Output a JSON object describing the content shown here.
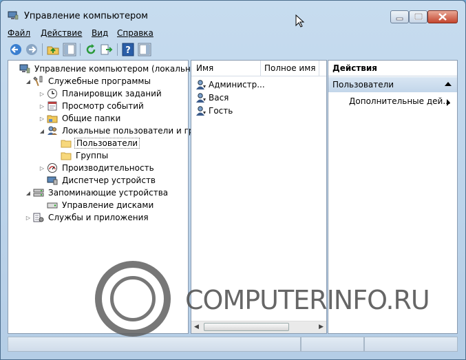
{
  "window": {
    "title": "Управление компьютером"
  },
  "menu": {
    "items": [
      {
        "label": "Файл",
        "accel": "Ф"
      },
      {
        "label": "Действие",
        "accel": "Д"
      },
      {
        "label": "Вид",
        "accel": "В"
      },
      {
        "label": "Справка",
        "accel": "С"
      }
    ]
  },
  "toolbar": {
    "icons": [
      "back-arrow-icon",
      "forward-arrow-icon",
      "up-folder-icon",
      "show-hide-tree-icon",
      "refresh-icon",
      "export-list-icon",
      "help-icon",
      "show-hide-action-pane-icon"
    ]
  },
  "tree": {
    "items": [
      {
        "label": "Управление компьютером (локальным)",
        "level": 0,
        "expander": "",
        "icon": "computer-management-icon"
      },
      {
        "label": "Служебные программы",
        "level": 1,
        "expander": "expanded",
        "icon": "system-tools-icon"
      },
      {
        "label": "Планировщик заданий",
        "level": 2,
        "expander": "collapsed",
        "icon": "clock-icon"
      },
      {
        "label": "Просмотр событий",
        "level": 2,
        "expander": "collapsed",
        "icon": "event-viewer-icon"
      },
      {
        "label": "Общие папки",
        "level": 2,
        "expander": "collapsed",
        "icon": "shared-folder-icon"
      },
      {
        "label": "Локальные пользователи и группы",
        "level": 2,
        "expander": "expanded",
        "icon": "users-groups-icon"
      },
      {
        "label": "Пользователи",
        "level": 3,
        "expander": "",
        "icon": "folder-icon",
        "selected": true
      },
      {
        "label": "Группы",
        "level": 3,
        "expander": "",
        "icon": "folder-icon"
      },
      {
        "label": "Производительность",
        "level": 2,
        "expander": "collapsed",
        "icon": "performance-icon"
      },
      {
        "label": "Диспетчер устройств",
        "level": 2,
        "expander": "",
        "icon": "device-manager-icon"
      },
      {
        "label": "Запоминающие устройства",
        "level": 1,
        "expander": "expanded",
        "icon": "storage-icon"
      },
      {
        "label": "Управление дисками",
        "level": 2,
        "expander": "",
        "icon": "disk-management-icon"
      },
      {
        "label": "Службы и приложения",
        "level": 1,
        "expander": "collapsed",
        "icon": "services-icon"
      }
    ]
  },
  "list": {
    "columns": [
      "Имя",
      "Полное имя"
    ],
    "rows": [
      {
        "name": "Администр...",
        "full_name": ""
      },
      {
        "name": "Вася",
        "full_name": ""
      },
      {
        "name": "Гость",
        "full_name": ""
      }
    ]
  },
  "actions": {
    "header": "Действия",
    "section": "Пользователи",
    "item": "Дополнительные дей..."
  },
  "watermark": {
    "text": "COMPUTERINFO.RU"
  },
  "colors": {
    "accent": "#c3d6ea",
    "close_button": "#c5462e"
  }
}
